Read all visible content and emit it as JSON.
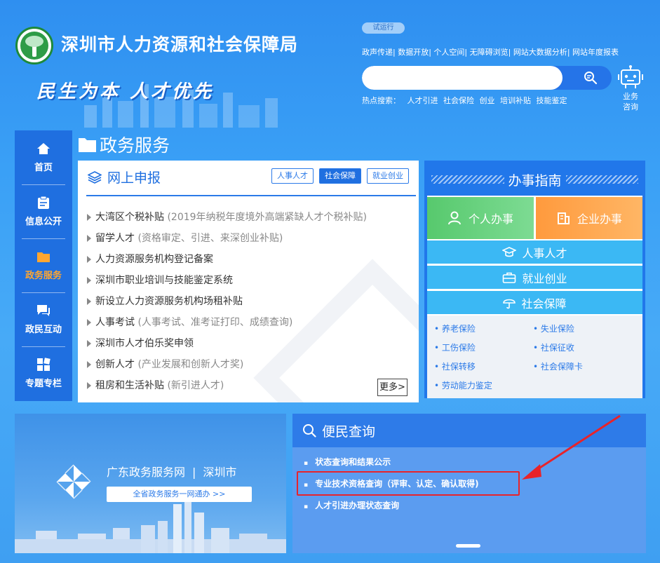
{
  "header": {
    "site_title": "深圳市人力资源和社会保障局",
    "slogan": "民生为本 人才优先",
    "trial_badge": "试运行",
    "top_links": [
      "政声传递",
      "数据开放",
      "个人空间",
      "无障碍浏览",
      "网站大数据分析",
      "网站年度报表"
    ],
    "search": {
      "placeholder": ""
    },
    "hot_search": {
      "label": "热点搜索：",
      "items": [
        "人才引进",
        "社会保险",
        "创业",
        "培训补贴",
        "技能鉴定"
      ]
    },
    "assistant_label": "业务咨询"
  },
  "left_nav": {
    "items": [
      {
        "label": "首页",
        "icon": "home-icon"
      },
      {
        "label": "信息公开",
        "icon": "clipboard-icon"
      },
      {
        "label": "政务服务",
        "icon": "folder-icon",
        "active": true
      },
      {
        "label": "政民互动",
        "icon": "chat-icon"
      },
      {
        "label": "专题专栏",
        "icon": "grid-icon"
      }
    ]
  },
  "services": {
    "section_title": "政务服务",
    "online": {
      "title": "网上申报",
      "tabs": [
        "人事人才",
        "社会保障",
        "就业创业"
      ],
      "active_tab": "社会保障",
      "items": [
        {
          "main": "大湾区个税补贴",
          "sub": " (2019年纳税年度境外高端紧缺人才个税补贴)"
        },
        {
          "main": "留学人才",
          "sub": " (资格审定、引进、来深创业补贴)"
        },
        {
          "main": "人力资源服务机构登记备案",
          "sub": ""
        },
        {
          "main": "深圳市职业培训与技能鉴定系统",
          "sub": ""
        },
        {
          "main": "新设立人力资源服务机构场租补贴",
          "sub": ""
        },
        {
          "main": "人事考试",
          "sub": " (人事考试、准考证打印、成绩查询)"
        },
        {
          "main": "深圳市人才伯乐奖申领",
          "sub": ""
        },
        {
          "main": "创新人才",
          "sub": " (产业发展和创新人才奖)"
        },
        {
          "main": "租房和生活补贴",
          "sub": " (新引进人才)"
        }
      ],
      "more_label": "更多>"
    },
    "guide": {
      "title": "办事指南",
      "big_buttons": [
        "个人办事",
        "企业办事"
      ],
      "rows": [
        "人事人才",
        "就业创业",
        "社会保障"
      ],
      "links_left": [
        "养老保险",
        "工伤保险",
        "社保转移",
        "劳动能力鉴定"
      ],
      "links_right": [
        "失业保险",
        "社保征收",
        "社会保障卡"
      ]
    }
  },
  "gd_banner": {
    "title_left": "广东政务服务网",
    "separator": "|",
    "title_right": "深圳市",
    "button": "全省政务服务一网通办 >>"
  },
  "query": {
    "title": "便民查询",
    "items": [
      "状态查询和结果公示",
      "专业技术资格查询（评审、认定、确认取得)",
      "人才引进办理状态查询"
    ],
    "highlighted_index": 1
  },
  "colors": {
    "primary": "#1f6fe0",
    "accent_orange": "#ffa630",
    "highlight_red": "#e8232a"
  }
}
